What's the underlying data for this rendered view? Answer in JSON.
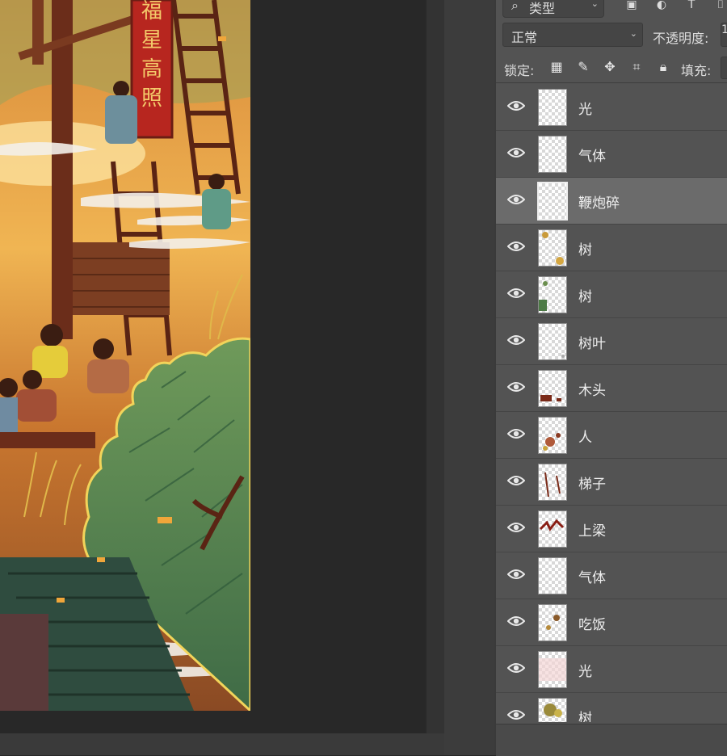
{
  "toolbar": {
    "filter_kind_label": "类型"
  },
  "blend": {
    "mode": "正常",
    "opacity_label": "不透明度:",
    "opacity_partial": "1"
  },
  "lock": {
    "label": "锁定:",
    "fill_label": "填充:"
  },
  "layers": [
    {
      "name": "光",
      "visible": true,
      "selected": false
    },
    {
      "name": "气体",
      "visible": true,
      "selected": false
    },
    {
      "name": "鞭炮碎",
      "visible": true,
      "selected": true
    },
    {
      "name": "树",
      "visible": true,
      "selected": false
    },
    {
      "name": "树",
      "visible": true,
      "selected": false
    },
    {
      "name": "树叶",
      "visible": true,
      "selected": false
    },
    {
      "name": "木头",
      "visible": true,
      "selected": false
    },
    {
      "name": "人",
      "visible": true,
      "selected": false
    },
    {
      "name": "梯子",
      "visible": true,
      "selected": false
    },
    {
      "name": "上梁",
      "visible": true,
      "selected": false
    },
    {
      "name": "气体",
      "visible": true,
      "selected": false
    },
    {
      "name": "吃饭",
      "visible": true,
      "selected": false
    },
    {
      "name": "光",
      "visible": true,
      "selected": false
    },
    {
      "name": "树",
      "visible": true,
      "selected": false
    }
  ],
  "artwork": {
    "banner_text": "福星高照"
  },
  "colors": {
    "panel_bg": "#535353",
    "selected_row": "#6b6b6b",
    "canvas_bg": "#282828",
    "text": "#eeeeee"
  }
}
